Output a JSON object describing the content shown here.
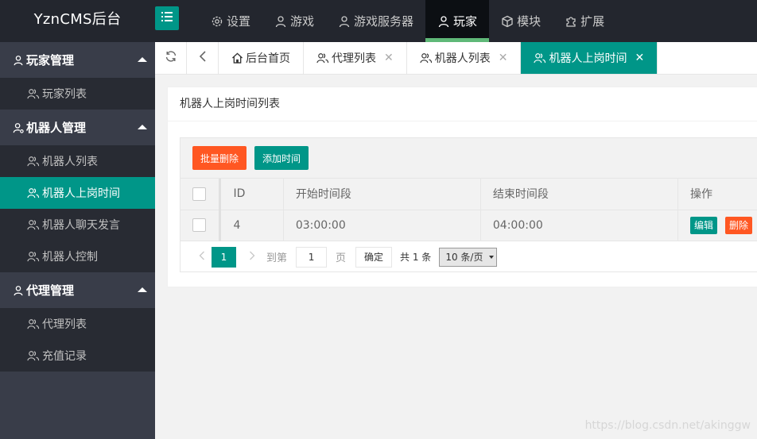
{
  "app": {
    "title": "YznCMS后台"
  },
  "topnav": [
    {
      "label": "设置",
      "icon": "gear-icon"
    },
    {
      "label": "游戏",
      "icon": "user-icon"
    },
    {
      "label": "游戏服务器",
      "icon": "user-icon"
    },
    {
      "label": "玩家",
      "icon": "user-icon",
      "active": true
    },
    {
      "label": "模块",
      "icon": "cube-icon"
    },
    {
      "label": "扩展",
      "icon": "puzzle-icon"
    }
  ],
  "sidebar": {
    "groups": [
      {
        "label": "玩家管理",
        "items": [
          {
            "label": "玩家列表"
          }
        ]
      },
      {
        "label": "机器人管理",
        "items": [
          {
            "label": "机器人列表"
          },
          {
            "label": "机器人上岗时间",
            "active": true
          },
          {
            "label": "机器人聊天发言"
          },
          {
            "label": "机器人控制"
          }
        ]
      },
      {
        "label": "代理管理",
        "items": [
          {
            "label": "代理列表"
          },
          {
            "label": "充值记录"
          }
        ]
      }
    ]
  },
  "tabs": [
    {
      "label": "后台首页",
      "icon": "home-icon"
    },
    {
      "label": "代理列表",
      "icon": "users-icon"
    },
    {
      "label": "机器人列表",
      "icon": "users-icon"
    },
    {
      "label": "机器人上岗时间",
      "icon": "users-icon",
      "active": true
    }
  ],
  "card": {
    "title": "机器人上岗时间列表"
  },
  "toolbar": {
    "batch_delete": "批量删除",
    "add_time": "添加时间"
  },
  "table": {
    "headers": {
      "id": "ID",
      "start": "开始时间段",
      "end": "结束时间段",
      "actions": "操作"
    },
    "rows": [
      {
        "id": "4",
        "start": "03:00:00",
        "end": "04:00:00",
        "edit": "编辑",
        "delete": "删除"
      }
    ]
  },
  "pager": {
    "current": "1",
    "goto_label": "到第",
    "goto_value": "1",
    "page_unit": "页",
    "confirm": "确定",
    "total": "共 1 条",
    "page_size": "10 条/页"
  },
  "watermark": "https://blog.csdn.net/akinggw",
  "colors": {
    "accent": "#009688",
    "danger": "#ff5722",
    "topbar": "#23262e",
    "sidebar": "#393d49"
  }
}
